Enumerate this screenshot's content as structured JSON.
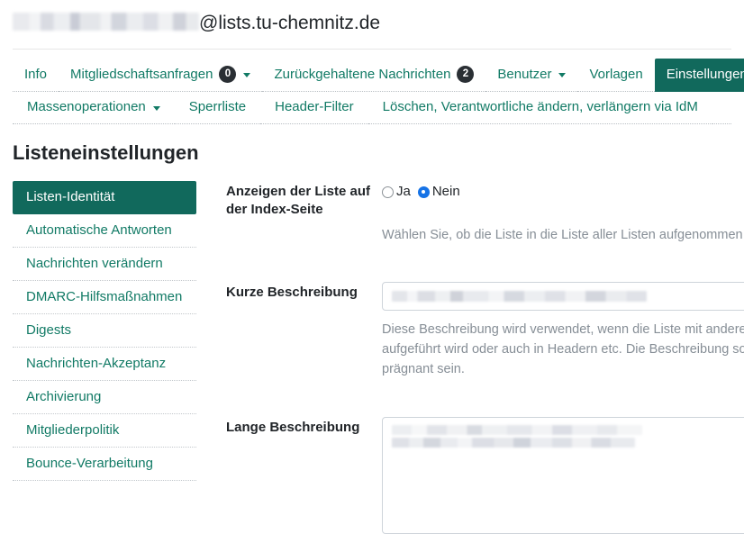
{
  "header": {
    "list_address_suffix": "@lists.tu-chemnitz.de",
    "list_address_redacted": true
  },
  "tabs": {
    "row1": [
      {
        "label": "Info",
        "badge": null,
        "caret": false,
        "active": false
      },
      {
        "label": "Mitgliedschaftsanfragen",
        "badge": "0",
        "caret": true,
        "active": false
      },
      {
        "label": "Zurückgehaltene Nachrichten",
        "badge": "2",
        "caret": false,
        "active": false
      },
      {
        "label": "Benutzer",
        "badge": null,
        "caret": true,
        "active": false
      },
      {
        "label": "Vorlagen",
        "badge": null,
        "caret": false,
        "active": false
      },
      {
        "label": "Einstellungen",
        "badge": null,
        "caret": false,
        "active": true
      }
    ],
    "row2": [
      {
        "label": "Massenoperationen",
        "badge": null,
        "caret": true,
        "active": false
      },
      {
        "label": "Sperrliste",
        "badge": null,
        "caret": false,
        "active": false
      },
      {
        "label": "Header-Filter",
        "badge": null,
        "caret": false,
        "active": false
      },
      {
        "label": "Löschen, Verantwortliche ändern, verlängern via IdM",
        "badge": null,
        "caret": false,
        "active": false
      }
    ]
  },
  "page_title": "Listeneinstellungen",
  "sidebar": {
    "items": [
      {
        "label": "Listen-Identität",
        "active": true
      },
      {
        "label": "Automatische Antworten",
        "active": false
      },
      {
        "label": "Nachrichten verändern",
        "active": false
      },
      {
        "label": "DMARC-Hilfsmaßnahmen",
        "active": false
      },
      {
        "label": "Digests",
        "active": false
      },
      {
        "label": "Nachrichten-Akzeptanz",
        "active": false
      },
      {
        "label": "Archivierung",
        "active": false
      },
      {
        "label": "Mitgliederpolitik",
        "active": false
      },
      {
        "label": "Bounce-Verarbeitung",
        "active": false
      }
    ]
  },
  "form": {
    "index_visibility": {
      "label": "Anzeigen der Liste auf der Index-Seite",
      "options": [
        {
          "label": "Ja",
          "checked": false
        },
        {
          "label": "Nein",
          "checked": true
        }
      ],
      "help": "Wählen Sie, ob die Liste in die Liste aller Listen aufgenommen w"
    },
    "short_description": {
      "label": "Kurze Beschreibung",
      "value_redacted": true,
      "help": "Diese Beschreibung wird verwendet, wenn die Liste mit anderen aufgeführt wird oder auch in Headern etc. Die Beschreibung sollt und prägnant sein."
    },
    "long_description": {
      "label": "Lange Beschreibung",
      "value_redacted": true
    }
  },
  "colors": {
    "brand_green": "#11695c",
    "link_teal": "#117a65",
    "badge_dark": "#2a2f34",
    "radio_blue": "#1673e6",
    "muted_text": "#868e96"
  }
}
